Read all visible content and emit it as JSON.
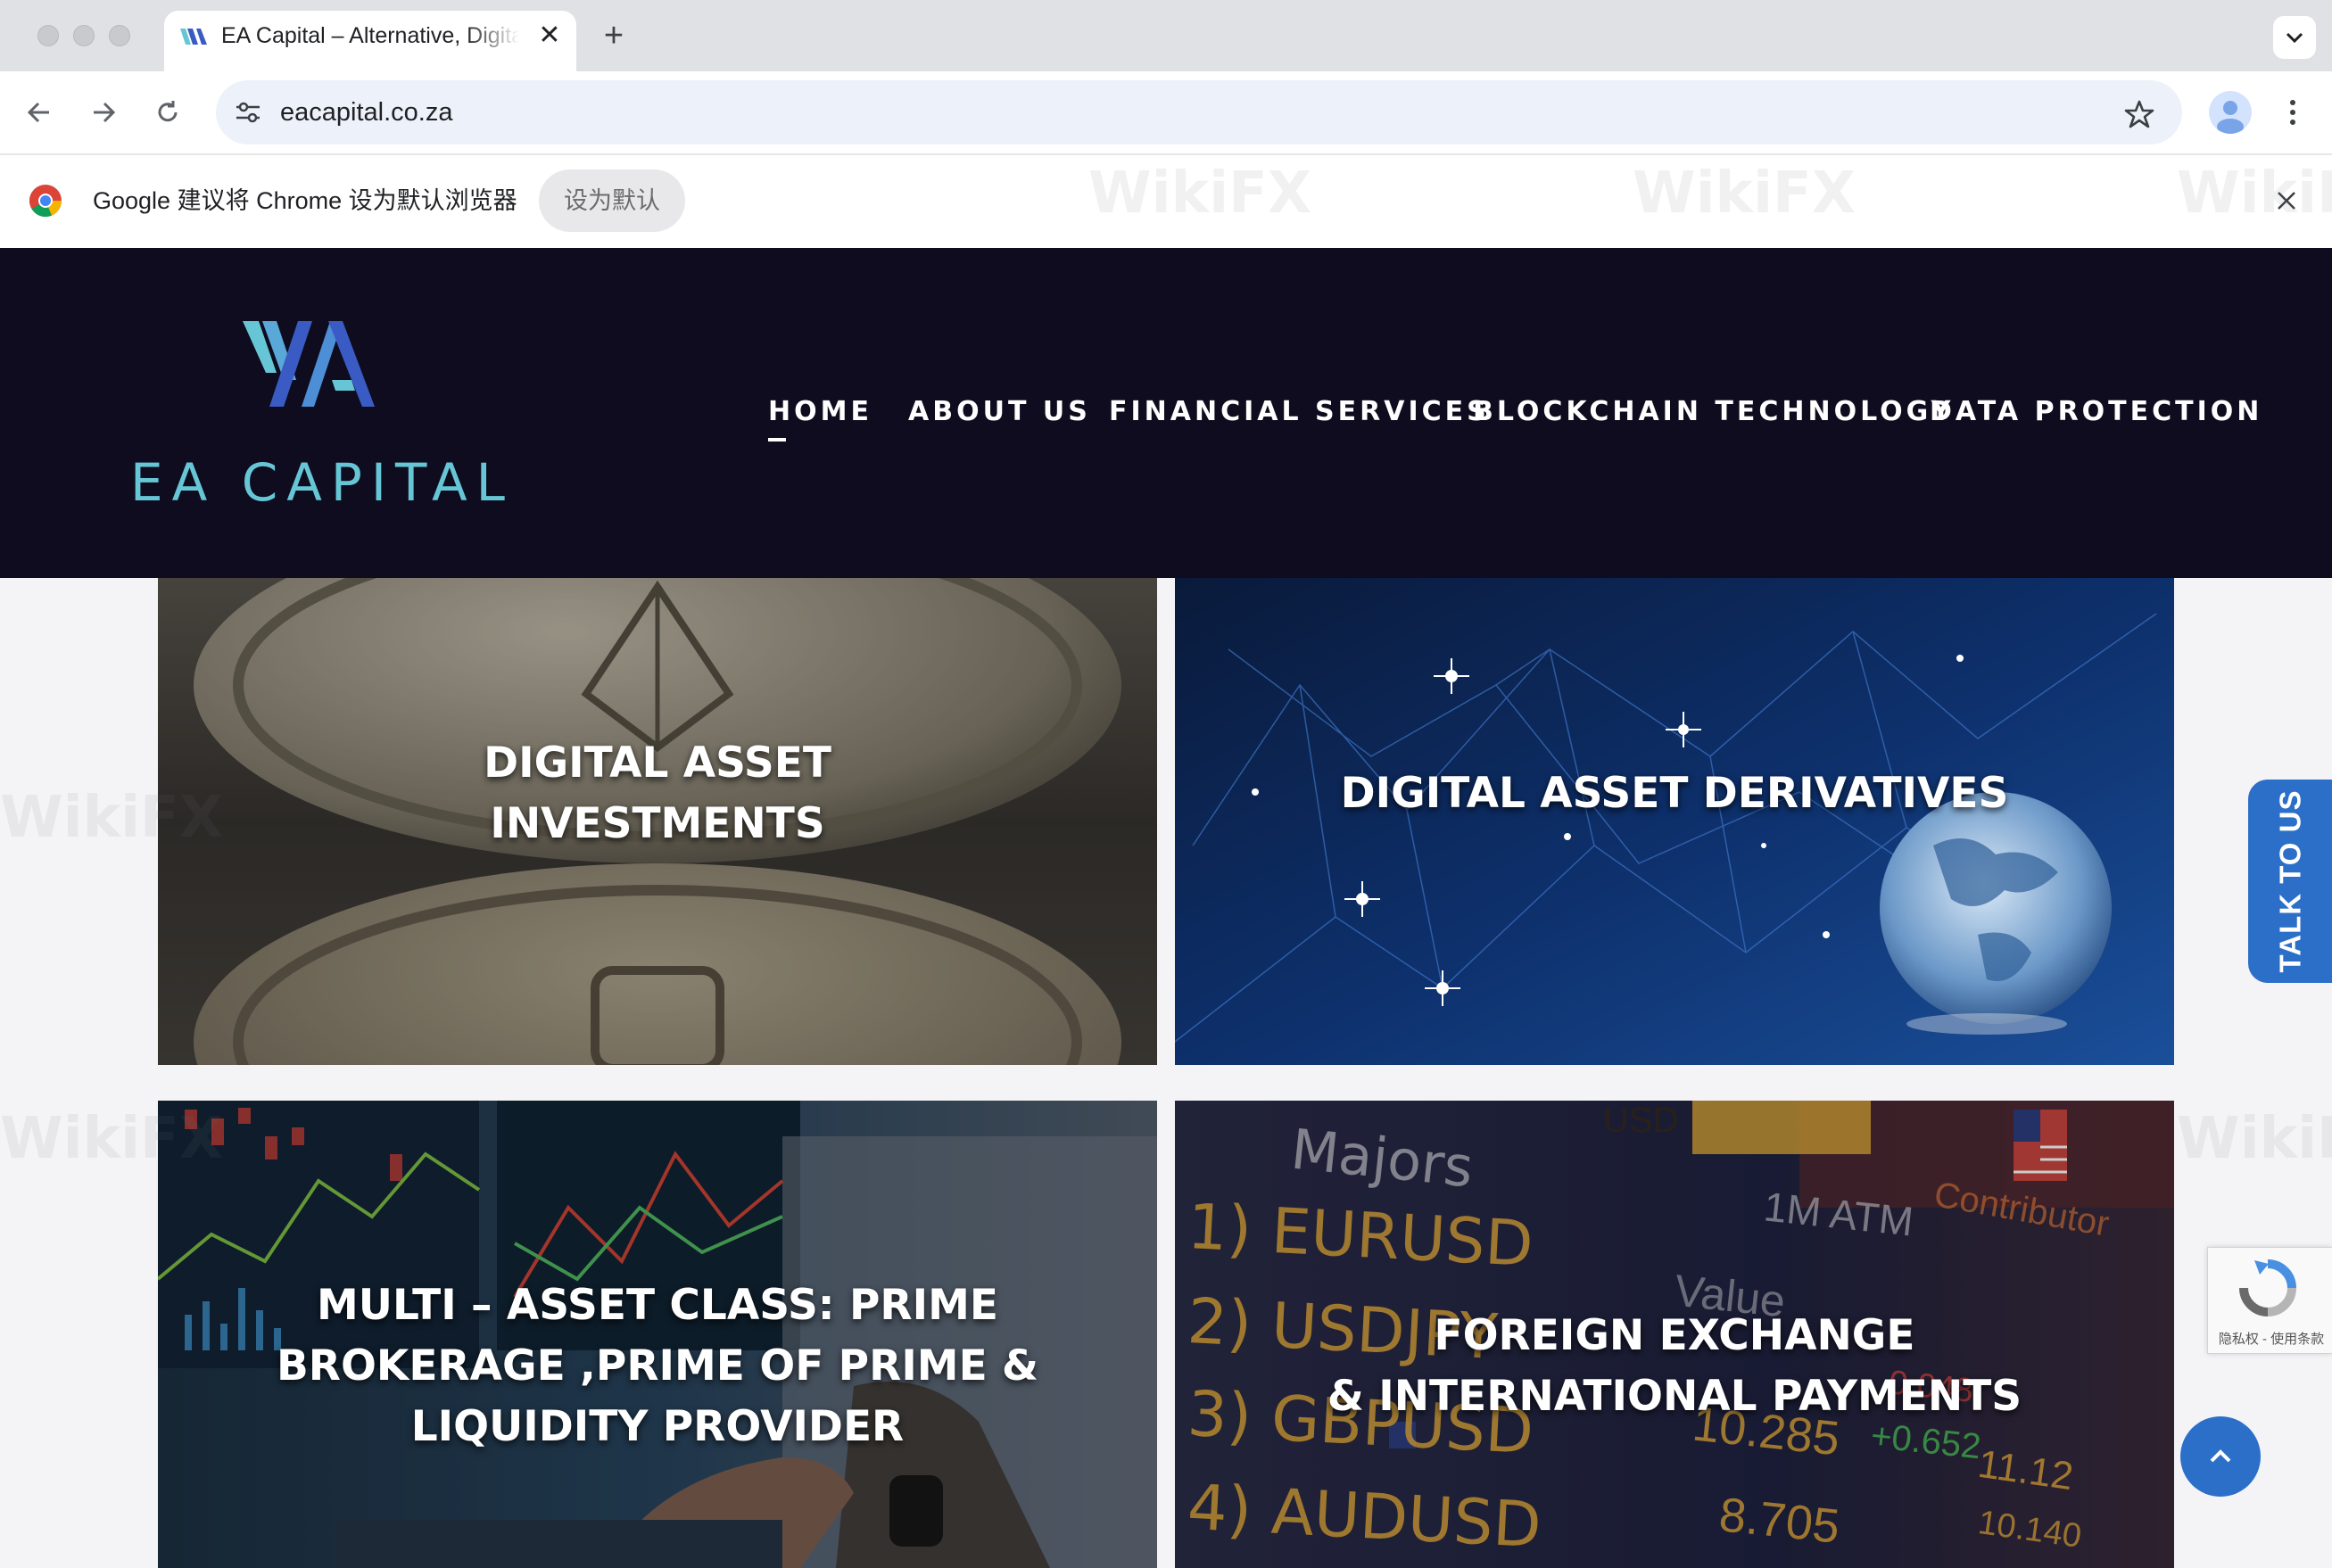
{
  "browser": {
    "tab_title": "EA Capital – Alternative, Digital Asset & Fintech Solutions",
    "tab_close": "✕",
    "new_tab": "+",
    "url": "eacapital.co.za",
    "infobar_text": "Google 建议将 Chrome 设为默认浏览器",
    "infobar_button": "设为默认"
  },
  "site": {
    "logo_text": "EA CAPITAL",
    "nav": [
      {
        "label": "HOME",
        "active": true
      },
      {
        "label": "ABOUT US"
      },
      {
        "label": "FINANCIAL SERVICES"
      },
      {
        "label": "BLOCKCHAIN TECHNOLOGY"
      },
      {
        "label": "DATA PROTECTION"
      }
    ],
    "cards": [
      {
        "line1": "DIGITAL ASSET",
        "line2": "INVESTMENTS"
      },
      {
        "line1": "DIGITAL ASSET DERIVATIVES"
      },
      {
        "line1": "MULTI – ASSET CLASS: PRIME",
        "line2": "BROKERAGE ,PRIME OF PRIME &",
        "line3": "LIQUIDITY PROVIDER"
      },
      {
        "line1": "FOREIGN EXCHANGE",
        "line2": "& INTERNATIONAL PAYMENTS"
      }
    ],
    "fx_board": {
      "heading": "Majors",
      "rows": [
        "1) EURUSD",
        "2) USDJPY",
        "3) GBPUSD",
        "4) AUDUSD"
      ],
      "labels": [
        "1M ATM",
        "Value",
        "Contributor",
        "USD"
      ],
      "numbers": [
        "10.285",
        "+0.652",
        "8.705",
        "11.12",
        "10.140",
        "0.048"
      ]
    }
  },
  "widgets": {
    "talk_to_us": "TALK TO US",
    "recaptcha_links": "隐私权 - 使用条款"
  },
  "watermark_text": "WikiFX",
  "colors": {
    "header_bg": "#0e0c1e",
    "logo_teal": "#67c6d6",
    "logo_blue": "#3b5bc4",
    "accent_blue": "#2b6fc9"
  }
}
